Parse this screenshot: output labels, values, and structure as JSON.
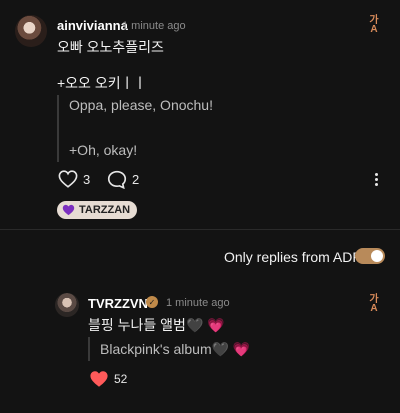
{
  "comment": {
    "username": "ainvivianna",
    "time": "1 minute ago",
    "line1": "오빠 오노추플리즈",
    "line2": "+오오 오키ㅣㅣ",
    "translation_line1": "Oppa, please, Onochu!",
    "translation_line2": "+Oh, okay!",
    "likes": "3",
    "replies": "2",
    "badge_label": "TARZZAN",
    "badge_color": "#7b2fbf"
  },
  "filter": {
    "label": "Only replies from ADP",
    "enabled": true,
    "accent": "#b88a5a"
  },
  "reply": {
    "username": "TVRZZVN",
    "time": "1 minute ago",
    "text": "블핑 누나들 앨범🖤 💗",
    "translation": "Blackpink's album🖤 💗",
    "likes": "52",
    "like_color": "#ff5a5a"
  },
  "icons": {
    "translate": "translate-icon",
    "heart": "heart-icon",
    "comment": "comment-icon",
    "more": "more-icon",
    "verified": "verified-badge-icon"
  }
}
